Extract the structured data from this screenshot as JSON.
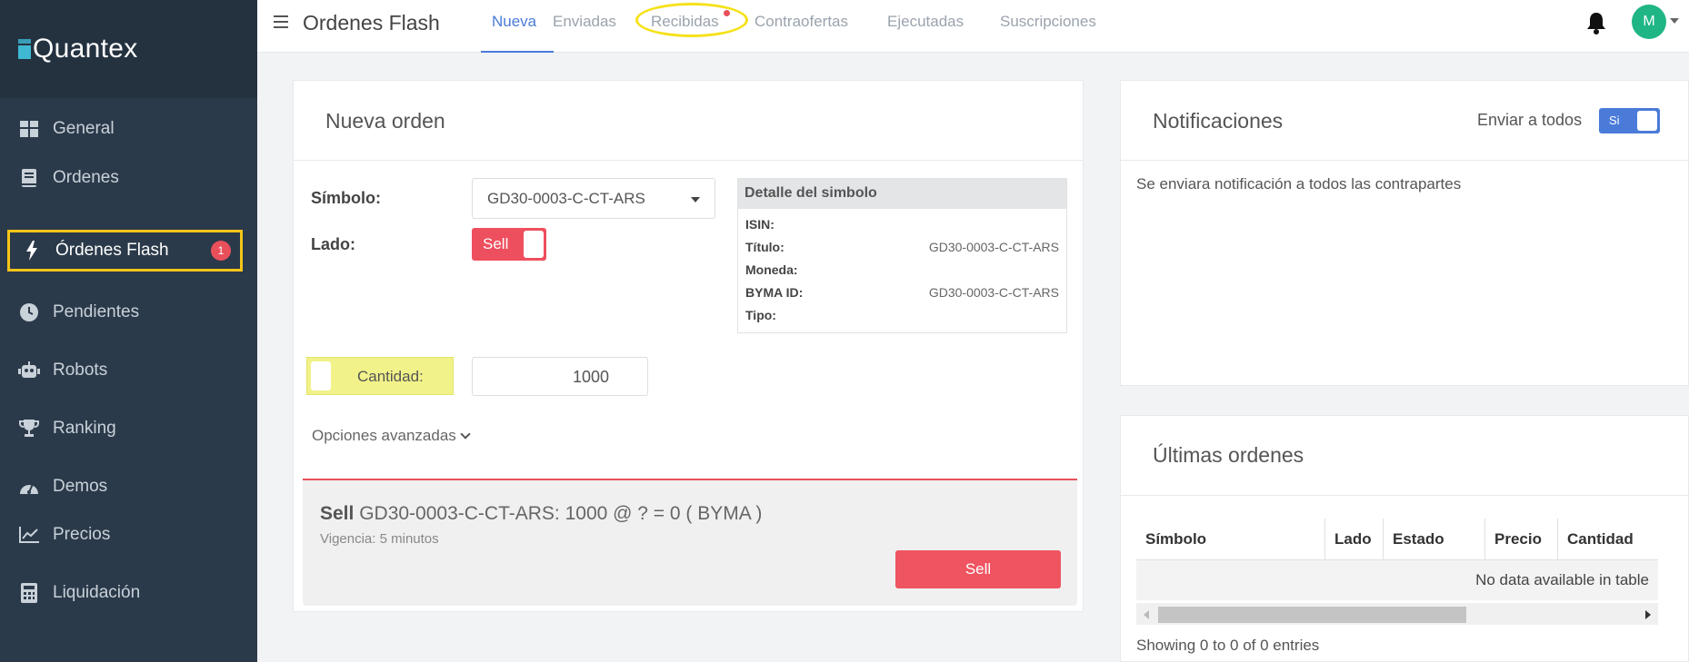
{
  "brand": {
    "name": "Quantex"
  },
  "sidebar": {
    "items": [
      {
        "label": "General",
        "icon": "dashboard-icon"
      },
      {
        "label": "Ordenes",
        "icon": "book-icon"
      },
      {
        "label": "Órdenes Flash",
        "icon": "bolt-icon",
        "badge": "1",
        "active": true
      },
      {
        "label": "Pendientes",
        "icon": "clock-icon"
      },
      {
        "label": "Robots",
        "icon": "robot-icon"
      },
      {
        "label": "Ranking",
        "icon": "trophy-icon"
      },
      {
        "label": "Demos",
        "icon": "gauge-icon"
      },
      {
        "label": "Precios",
        "icon": "chart-line-icon"
      },
      {
        "label": "Liquidación",
        "icon": "calculator-icon"
      }
    ]
  },
  "header": {
    "title": "Ordenes Flash",
    "tabs": [
      {
        "label": "Nueva",
        "active": true
      },
      {
        "label": "Enviadas"
      },
      {
        "label": "Recibidas",
        "notification": true
      },
      {
        "label": "Contraofertas"
      },
      {
        "label": "Ejecutadas"
      },
      {
        "label": "Suscripciones"
      }
    ],
    "avatar": "M"
  },
  "nueva_orden": {
    "title": "Nueva orden",
    "simbolo_label": "Símbolo:",
    "simbolo_value": "GD30-0003-C-CT-ARS",
    "lado_label": "Lado:",
    "lado_value": "Sell",
    "cantidad_label": "Cantidad:",
    "cantidad_value": "1000",
    "opciones": "Opciones avanzadas",
    "detalle": {
      "title": "Detalle del simbolo",
      "rows": [
        {
          "k": "ISIN:",
          "v": ""
        },
        {
          "k": "Título:",
          "v": "GD30-0003-C-CT-ARS"
        },
        {
          "k": "Moneda:",
          "v": ""
        },
        {
          "k": "BYMA ID:",
          "v": "GD30-0003-C-CT-ARS"
        },
        {
          "k": "Tipo:",
          "v": ""
        }
      ]
    },
    "summary": {
      "side": "Sell",
      "text": " GD30-0003-C-CT-ARS: 1000 @ ? = 0 ( BYMA )",
      "vigencia": "Vigencia: 5 minutos",
      "button": "Sell"
    }
  },
  "notificaciones": {
    "title": "Notificaciones",
    "send_all_label": "Enviar a todos",
    "toggle": "Si",
    "message": "Se enviara notificación a todos las contrapartes"
  },
  "ultimas": {
    "title": "Últimas ordenes",
    "columns": [
      "Símbolo",
      "Lado",
      "Estado",
      "Precio",
      "Cantidad"
    ],
    "empty": "No data available in table",
    "info": "Showing 0 to 0 of 0 entries"
  },
  "colors": {
    "sidebar": "#2b3a4a",
    "accent": "#4a7bd8",
    "sell": "#ef5461",
    "highlight": "#f5c518",
    "avatar": "#1fb585"
  }
}
